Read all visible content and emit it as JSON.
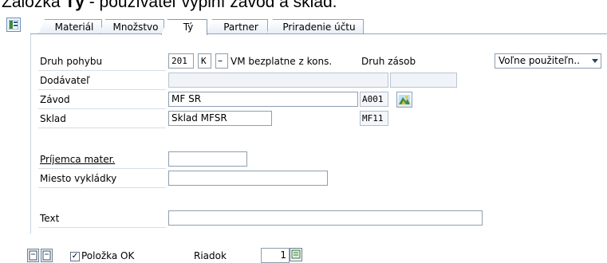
{
  "caption": {
    "prefix": "Záložka ",
    "bold": "Tý",
    "suffix": " - používateľ vyplní závod a sklad."
  },
  "tabs": [
    {
      "label": "Materiál"
    },
    {
      "label": "Množstvo"
    },
    {
      "label": "Tý"
    },
    {
      "label": "Partner"
    },
    {
      "label": "Priradenie účtu"
    }
  ],
  "form": {
    "druh_pohybu": {
      "label": "Druh pohybu",
      "code": "201",
      "flag": "K",
      "dash": "–",
      "desc": "VM bezplatne z kons."
    },
    "druh_zasob": {
      "label": "Druh zásob",
      "value": "Voľne použiteľn.."
    },
    "dodavatel": {
      "label": "Dodávateľ",
      "value": ""
    },
    "zavod": {
      "label": "Závod",
      "value": "MF SR",
      "code": "A001"
    },
    "sklad": {
      "label": "Sklad",
      "value": "Sklad MFSR",
      "code": "MF11"
    },
    "prijemca": {
      "label": "Príjemca mater.",
      "value": ""
    },
    "miesto": {
      "label": "Miesto vykládky",
      "value": ""
    },
    "text": {
      "label": "Text",
      "value": ""
    }
  },
  "bottom": {
    "polozka_ok": "Položka OK",
    "riadok_label": "Riadok",
    "riadok_value": "1"
  },
  "icons": {
    "side": "layout-toggle-icon",
    "plant": "plant-overview-icon",
    "prev": "document-prev-icon",
    "next": "document-next-icon",
    "pick": "select-line-icon"
  },
  "colors": {
    "tab_border": "#8ea6c1",
    "field_border": "#8f9eb0"
  }
}
